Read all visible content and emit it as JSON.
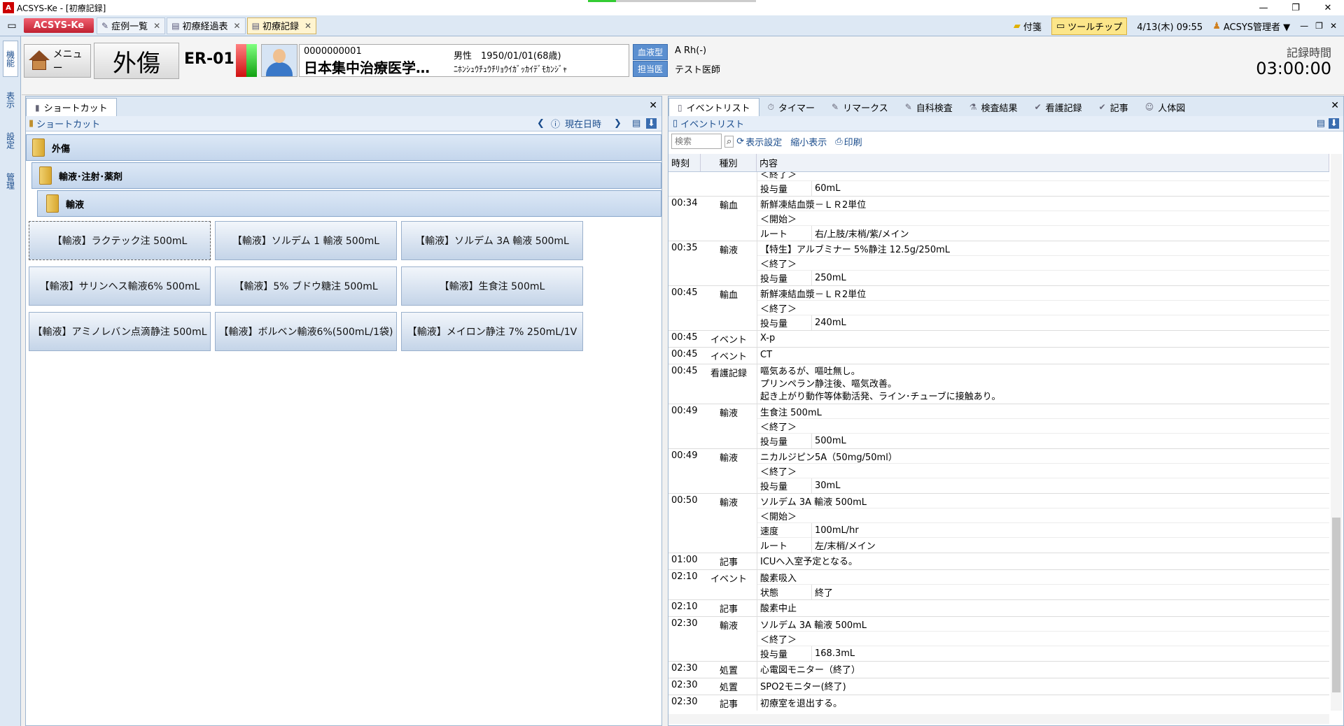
{
  "window": {
    "title": "ACSYS-Ke - [初療記録]",
    "app_icon": "A"
  },
  "tabstrip": {
    "brand": "ACSYS-Ke",
    "tabs": [
      {
        "label": "症例一覧",
        "icon": "list-icon"
      },
      {
        "label": "初療経過表",
        "icon": "chart-icon"
      },
      {
        "label": "初療記録",
        "icon": "record-icon",
        "active": true
      }
    ],
    "sticky_label": "付箋",
    "tooltip_label": "ツールチップ",
    "datetime": "4/13(木) 09:55",
    "user": "ACSYS管理者 ▼"
  },
  "leftstrip": {
    "items": [
      "機能",
      "表示",
      "設定",
      "管理"
    ]
  },
  "patient": {
    "menu_label": "メニュー",
    "category": "外傷",
    "room": "ER-01",
    "id": "0000000001",
    "name": "日本集中治療医学…",
    "sex_dob": "男性　1950/01/01(68歳)",
    "kana": "ﾆﾎﾝｼｭｳﾁｭｳﾁﾘｮｳｲｶﾞｯｶｲﾃﾞﾓｶﾝｼﾞｬ",
    "blood_label": "血液型",
    "blood_value": "A Rh(-)",
    "doctor_label": "担当医",
    "doctor_value": "テスト医師",
    "record_time_label": "記録時間",
    "record_time": "03:00:00"
  },
  "shortcut": {
    "tab_label": "ショートカット",
    "sub_label": "ショートカット",
    "now_label": "現在日時",
    "folders": [
      "外傷",
      "輸液･注射･薬剤",
      "輸液"
    ],
    "buttons": [
      "【輸液】ラクテック注 500mL",
      "【輸液】ソルデム 1 輸液 500mL",
      "【輸液】ソルデム 3A 輸液 500mL",
      "【輸液】サリンヘス輸液6% 500mL",
      "【輸液】5% ブドウ糖注 500mL",
      "【輸液】生食注 500mL",
      "【輸液】アミノレバン点滴静注 500mL",
      "【輸液】ボルベン輸液6%(500mL/1袋)",
      "【輸液】メイロン静注 7% 250mL/1V"
    ]
  },
  "events": {
    "tabs": [
      "イベントリスト",
      "タイマー",
      "リマークス",
      "自科検査",
      "検査結果",
      "看護記録",
      "記事",
      "人体図"
    ],
    "sub_label": "イベントリスト",
    "search_placeholder": "検索",
    "display_settings": "表示設定",
    "compact": "縮小表示",
    "print": "印刷",
    "columns": [
      "時刻",
      "種別",
      "内容"
    ],
    "rows": [
      {
        "time": "",
        "kind": "",
        "lines": [
          {
            "text": "＜終了＞"
          },
          {
            "k": "投与量",
            "v": "60mL"
          }
        ]
      },
      {
        "time": "00:34",
        "kind": "輸血",
        "lines": [
          {
            "text": "新鮮凍結血漿－ＬＲ2単位"
          },
          {
            "text": "＜開始＞"
          },
          {
            "k": "ルート",
            "v": "右/上肢/末梢/紫/メイン"
          }
        ]
      },
      {
        "time": "00:35",
        "kind": "輸液",
        "lines": [
          {
            "text": "【特生】アルブミナー 5%静注 12.5g/250mL"
          },
          {
            "text": "＜終了＞"
          },
          {
            "k": "投与量",
            "v": "250mL"
          }
        ]
      },
      {
        "time": "00:45",
        "kind": "輸血",
        "lines": [
          {
            "text": "新鮮凍結血漿－ＬＲ2単位"
          },
          {
            "text": "＜終了＞"
          },
          {
            "k": "投与量",
            "v": "240mL"
          }
        ]
      },
      {
        "time": "00:45",
        "kind": "イベント",
        "lines": [
          {
            "text": "X-p"
          }
        ]
      },
      {
        "time": "00:45",
        "kind": "イベント",
        "lines": [
          {
            "text": "CT"
          }
        ]
      },
      {
        "time": "00:45",
        "kind": "看護記録",
        "note": [
          "嘔気あるが、嘔吐無し。",
          "プリンペラン静注後、嘔気改善。",
          "起き上がり動作等体動活発、ライン･チューブに接触あり。"
        ]
      },
      {
        "time": "00:49",
        "kind": "輸液",
        "lines": [
          {
            "text": "生食注 500mL"
          },
          {
            "text": "＜終了＞"
          },
          {
            "k": "投与量",
            "v": "500mL"
          }
        ]
      },
      {
        "time": "00:49",
        "kind": "輸液",
        "lines": [
          {
            "text": "ニカルジピン5A（50mg/50ml）"
          },
          {
            "text": "＜終了＞"
          },
          {
            "k": "投与量",
            "v": "30mL"
          }
        ]
      },
      {
        "time": "00:50",
        "kind": "輸液",
        "lines": [
          {
            "text": "ソルデム 3A 輸液 500mL"
          },
          {
            "text": "＜開始＞"
          },
          {
            "k": "速度",
            "v": "100mL/hr"
          },
          {
            "k": "ルート",
            "v": "左/末梢/メイン"
          }
        ]
      },
      {
        "time": "01:00",
        "kind": "記事",
        "lines": [
          {
            "text": "ICUへ入室予定となる。"
          }
        ]
      },
      {
        "time": "02:10",
        "kind": "イベント",
        "lines": [
          {
            "text": "酸素吸入"
          },
          {
            "k": "状態",
            "v": "終了"
          }
        ]
      },
      {
        "time": "02:10",
        "kind": "記事",
        "lines": [
          {
            "text": "酸素中止"
          }
        ]
      },
      {
        "time": "02:30",
        "kind": "輸液",
        "lines": [
          {
            "text": "ソルデム 3A 輸液 500mL"
          },
          {
            "text": "＜終了＞"
          },
          {
            "k": "投与量",
            "v": "168.3mL"
          }
        ]
      },
      {
        "time": "02:30",
        "kind": "処置",
        "lines": [
          {
            "text": "心電図モニター（終了）"
          }
        ]
      },
      {
        "time": "02:30",
        "kind": "処置",
        "lines": [
          {
            "text": "SPO2モニター(終了)"
          }
        ]
      },
      {
        "time": "02:30",
        "kind": "記事",
        "lines": [
          {
            "text": "初療室を退出する。"
          }
        ]
      }
    ]
  }
}
